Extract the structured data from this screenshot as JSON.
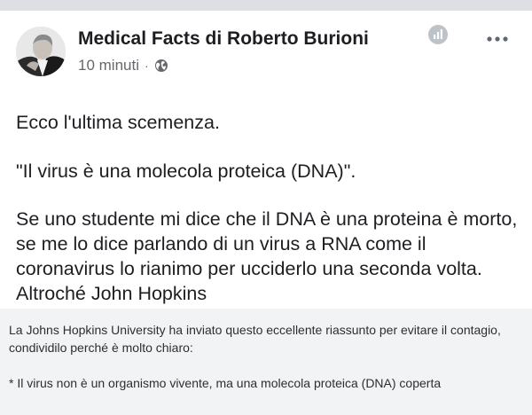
{
  "post": {
    "page_name": "Medical Facts di Roberto Burioni",
    "time": "10 minuti",
    "separator": "·",
    "privacy_icon": "globe-icon",
    "insights_icon": "insights-icon",
    "more_icon": "more-options-icon",
    "text": {
      "line1": "Ecco l'ultima scemenza.",
      "line2": "\"Il virus è una molecola proteica (DNA)\".",
      "line3": "Se uno studente mi dice che il DNA è una proteina è morto, se me lo dice parlando di un virus a RNA come il coronavirus lo rianimo per ucciderlo una seconda volta. Altroché John Hopkins"
    }
  },
  "shared_image": {
    "para1": "La Johns Hopkins University ha inviato questo eccellente riassunto per evitare il contagio, condividilo perché è molto chiaro:",
    "para2": "* Il virus non è un organismo vivente, ma una molecola proteica (DNA) coperta"
  },
  "colors": {
    "text": "#1c1e21",
    "meta": "#65676b",
    "shared_bg": "#f2f3f5",
    "top_strip": "#dddfe3"
  }
}
